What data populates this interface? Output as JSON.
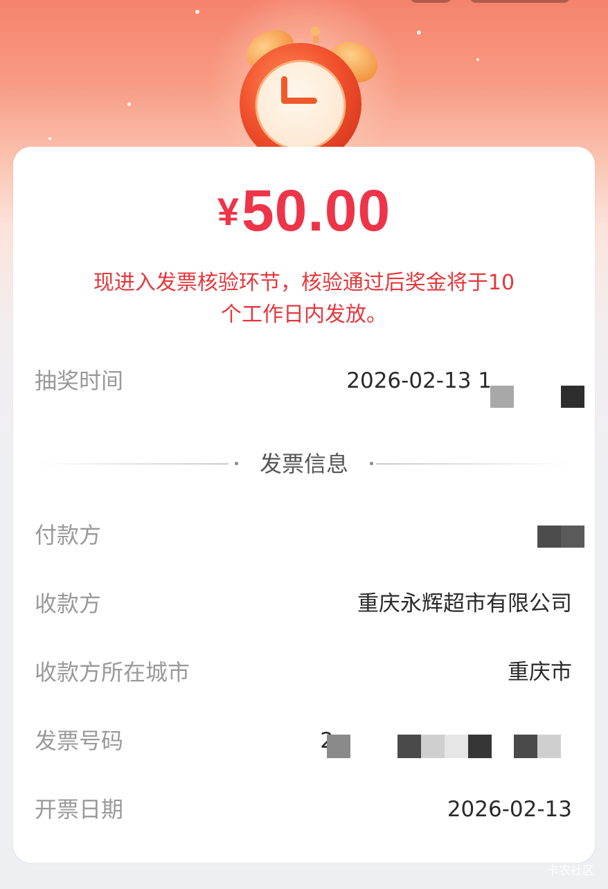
{
  "prize": {
    "currency": "¥",
    "amount": "50.00"
  },
  "notice": [
    "现进入发票核验环节，核验通过后奖金将于10",
    "个工作日内发放。"
  ],
  "draw_time": {
    "label": "抽奖时间",
    "value": "2026-02-13 1"
  },
  "invoice_section": {
    "title": "发票信息"
  },
  "payer": {
    "label": "付款方",
    "value": ""
  },
  "payee": {
    "label": "收款方",
    "value": "重庆永辉超市有限公司"
  },
  "payee_city": {
    "label": "收款方所在城市",
    "value": "重庆市"
  },
  "invoice_number": {
    "label": "发票号码",
    "value": "2"
  },
  "invoice_date": {
    "label": "开票日期",
    "value": "2026-02-13"
  },
  "watermark": "卡农社区",
  "colors": {
    "accent": "#ee3448",
    "notice": "#e5373b",
    "header": "#f5836c"
  },
  "icons": [
    "alarm-clock-icon"
  ]
}
